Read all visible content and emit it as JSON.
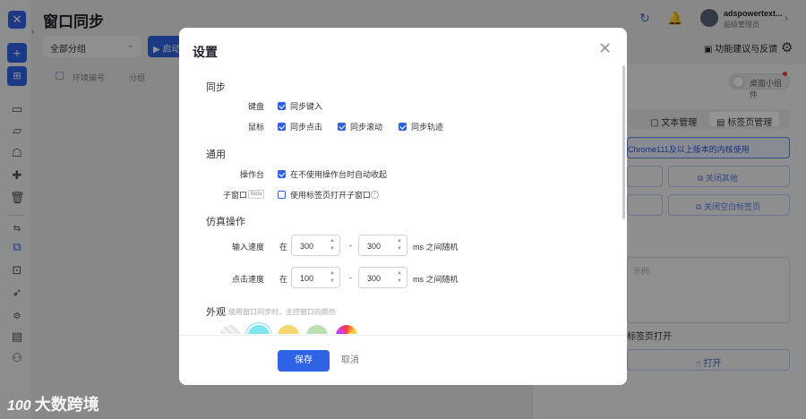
{
  "window": {
    "title": "窗口同步"
  },
  "rail": {
    "icons": [
      "logo",
      "add",
      "import",
      "folder",
      "folder-open",
      "profile",
      "extension",
      "trash",
      "sync",
      "api",
      "rocket",
      "monitor",
      "team"
    ]
  },
  "topbar": {
    "user_name": "adspowertext...",
    "user_role": "超级管理员"
  },
  "background": {
    "group_select": "全部分组",
    "start_button": "启动",
    "columns": [
      "环境编号",
      "分组"
    ],
    "feedback": "功能建议与反馈",
    "widget_toggle": "桌面小组件",
    "tabs": [
      "文本管理",
      "标签页管理"
    ],
    "note": "Chrome111及以上版本的内核使用",
    "btn_close_others": "关闭其他",
    "btn_close_blank": "关闭空白标签页",
    "example_placeholder": "示例:",
    "tab_open_label": "标签页打开",
    "open_button": "打开"
  },
  "dialog": {
    "title": "设置",
    "sync": {
      "title": "同步",
      "keyboard_label": "键盘",
      "keyboard_sync": "同步键入",
      "mouse_label": "鼠标",
      "mouse_click": "同步点击",
      "mouse_scroll": "同步滚动",
      "mouse_track": "同步轨迹"
    },
    "general": {
      "title": "通用",
      "console_label": "操作台",
      "console_option": "在不使用操作台时自动收起",
      "subwindow_label": "子窗口",
      "beta": "Beta",
      "subwindow_option": "使用标签页打开子窗口"
    },
    "simulate": {
      "title": "仿真操作",
      "input_speed_label": "输入速度",
      "click_speed_label": "点击速度",
      "in": "在",
      "dash": "-",
      "suffix": "ms 之间随机",
      "input_min": "300",
      "input_max": "300",
      "click_min": "100",
      "click_max": "300"
    },
    "appearance": {
      "title": "外观",
      "note": "使用窗口同步时，主控窗口的颜色",
      "colors": [
        "#eeeeee",
        "#7fe3f0",
        "#f5d76e",
        "#b9dfb0",
        "conic"
      ]
    },
    "save_label": "保存",
    "cancel_label": "取消"
  },
  "watermark": {
    "text": "大数跨境",
    "mark": "100"
  }
}
